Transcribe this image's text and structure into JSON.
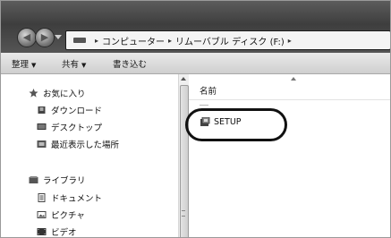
{
  "address": {
    "segments": [
      "コンピューター",
      "リムーバブル ディスク (F:)"
    ],
    "separator": "▸"
  },
  "toolbar": {
    "organize": "整理",
    "share": "共有",
    "burn": "書き込む"
  },
  "nav": {
    "favorites": {
      "label": "お気に入り",
      "items": [
        "ダウンロード",
        "デスクトップ",
        "最近表示した場所"
      ]
    },
    "libraries": {
      "label": "ライブラリ",
      "items": [
        "ドキュメント",
        "ピクチャ",
        "ビデオ"
      ]
    }
  },
  "content": {
    "column_name": "名前",
    "files": [
      {
        "name": "SETUP",
        "icon": "setup-installer-icon"
      }
    ]
  },
  "colors": {
    "highlight": "#111111",
    "titlebar": "#4a4a4a"
  }
}
